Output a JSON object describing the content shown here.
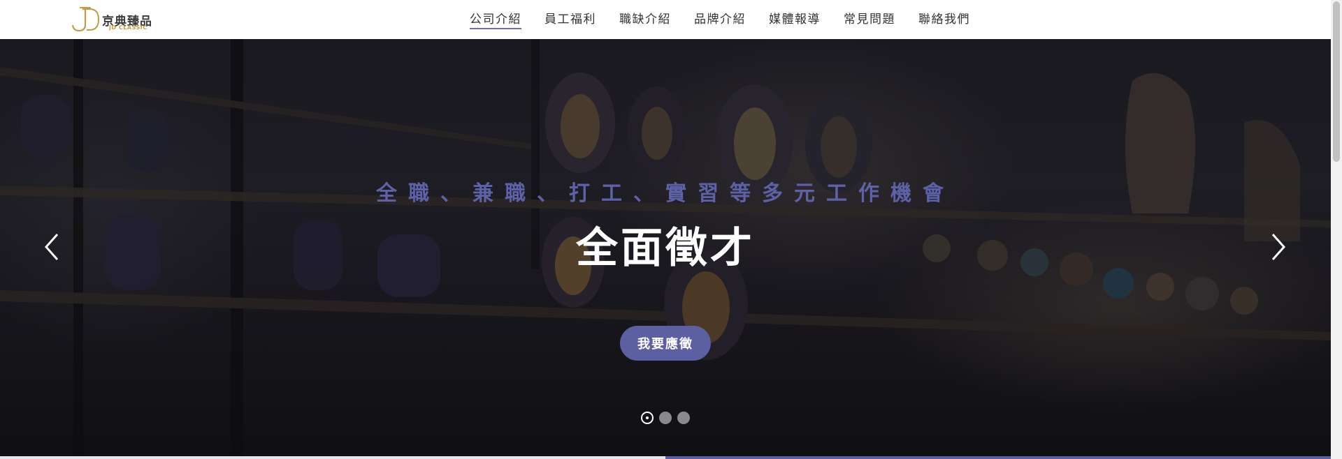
{
  "logo": {
    "name": "京典臻品",
    "sub": "JD CLASSIC",
    "icon": "jd-monogram-icon",
    "color": "#c39b4a"
  },
  "nav": {
    "items": [
      {
        "label": "公司介紹",
        "active": true
      },
      {
        "label": "員工福利",
        "active": false
      },
      {
        "label": "職缺介紹",
        "active": false
      },
      {
        "label": "品牌介紹",
        "active": false
      },
      {
        "label": "媒體報導",
        "active": false
      },
      {
        "label": "常見問題",
        "active": false
      },
      {
        "label": "聯絡我們",
        "active": false
      }
    ],
    "active_underline_color": "#6b6ea8"
  },
  "hero": {
    "subtitle": "全職、兼職、打工、實習等多元工作機會",
    "title": "全面徵才",
    "apply_label": "我要應徵",
    "accent": "#5c5fa1",
    "prev_icon": "chevron-left-icon",
    "next_icon": "chevron-right-icon",
    "slides_total": 3,
    "active_slide": 1,
    "slide_progress": 0.5
  }
}
